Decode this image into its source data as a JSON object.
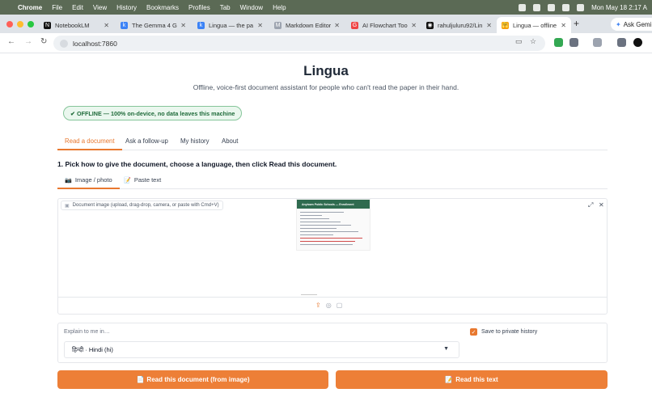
{
  "menubar": {
    "apple": "",
    "items": [
      "Chrome",
      "File",
      "Edit",
      "View",
      "History",
      "Bookmarks",
      "Profiles",
      "Tab",
      "Window",
      "Help"
    ],
    "datetime": "Mon May 18  2:17 A"
  },
  "browser": {
    "tabs": [
      {
        "title": "NotebookLM",
        "favicon": "N",
        "color": "#111111"
      },
      {
        "title": "The Gemma 4 Gu",
        "favicon": "k",
        "color": "#3b82f6"
      },
      {
        "title": "Lingua — the pa",
        "favicon": "k",
        "color": "#3b82f6"
      },
      {
        "title": "Markdown Editor",
        "favicon": "M",
        "color": "#e5e7eb"
      },
      {
        "title": "AI Flowchart Too",
        "favicon": "G",
        "color": "#ef4444"
      },
      {
        "title": "rahuljuluru92/Lin",
        "favicon": "◉",
        "color": "#111111"
      },
      {
        "title": "Lingua — offline",
        "favicon": "🤗",
        "color": "#f59e0b"
      }
    ],
    "new_tab": "+",
    "ask_gemini": "Ask Gemi",
    "url": "localhost:7860"
  },
  "page": {
    "title": "Lingua",
    "subtitle": "Offline, voice-first document assistant for people who can't read the paper in their hand.",
    "badge": "✔ OFFLINE — 100% on-device, no data leaves this machine",
    "tabs": [
      "Read a document",
      "Ask a follow-up",
      "My history",
      "About"
    ],
    "active_tab": "Read a document",
    "step": "1. Pick how to give the document, choose a language, then click Read this document.",
    "input_tabs": [
      {
        "icon": "📷",
        "label": "Image / photo"
      },
      {
        "icon": "📝",
        "label": "Paste text"
      }
    ],
    "upload": {
      "label": "Document image (upload, drag-drop, camera, or paste with Cmd+V)",
      "doc_header": "Anytown Public Schools — Enrollment",
      "doc_line": "Welcome! Please return this form by",
      "fullscreen_icon": "⤢",
      "clear_icon": "✕",
      "upload_icon": "⇪",
      "webcam_icon": "◎",
      "paste_icon": "▢"
    },
    "explain": {
      "label": "Explain to me in…",
      "selected_language": "हिन्दी · Hindi (hi)",
      "save_history_label": "Save to private history",
      "save_history_checked": true
    },
    "buttons": {
      "read_image": {
        "icon": "📄",
        "label": "Read this document (from image)"
      },
      "read_text": {
        "icon": "📝",
        "label": "Read this text"
      }
    }
  },
  "colors": {
    "accent": "#ed7f37",
    "badge_green": "#1f6b3a",
    "doc_header": "#2f6b4f"
  }
}
